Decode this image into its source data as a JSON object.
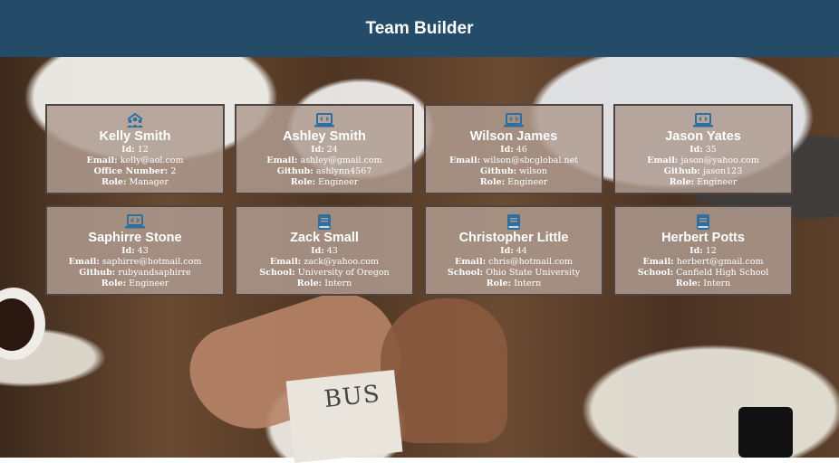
{
  "header": {
    "title": "Team Builder"
  },
  "labels": {
    "id": "Id:",
    "email": "Email:",
    "office": "Office Number:",
    "github": "Github:",
    "school": "School:",
    "role": "Role:"
  },
  "colors": {
    "header_bg": "#244b67",
    "icon": "#2f6f9f",
    "card_bg": "#af9b8f"
  },
  "background_text": "BUS",
  "employees": [
    {
      "name": "Kelly Smith",
      "icon": "manager-team-icon",
      "id": "12",
      "email": "kelly@aol.com",
      "extra": "2",
      "role": "Manager"
    },
    {
      "name": "Ashley Smith",
      "icon": "laptop-code-icon",
      "id": "24",
      "email": "ashley@gmail.com",
      "extra": "ashlynn4567",
      "role": "Engineer"
    },
    {
      "name": "Wilson James",
      "icon": "laptop-code-icon",
      "id": "46",
      "email": "wilson@sbcglobal.net",
      "extra": "wilson",
      "role": "Engineer"
    },
    {
      "name": "Jason Yates",
      "icon": "laptop-code-icon",
      "id": "35",
      "email": "jason@yahoo.com",
      "extra": "jason123",
      "role": "Engineer"
    },
    {
      "name": "Saphirre Stone",
      "icon": "laptop-code-icon",
      "id": "43",
      "email": "saphirre@hotmail.com",
      "extra": "rubyandsaphirre",
      "role": "Engineer"
    },
    {
      "name": "Zack Small",
      "icon": "book-icon",
      "id": "43",
      "email": "zack@yahoo.com",
      "extra": "University of Oregon",
      "role": "Intern"
    },
    {
      "name": "Christopher Little",
      "icon": "book-icon",
      "id": "44",
      "email": "chris@hotmail.com",
      "extra": "Ohio State University",
      "role": "Intern"
    },
    {
      "name": "Herbert Potts",
      "icon": "book-icon",
      "id": "12",
      "email": "herbert@gmail.com",
      "extra": "Canfield High School",
      "role": "Intern"
    }
  ]
}
